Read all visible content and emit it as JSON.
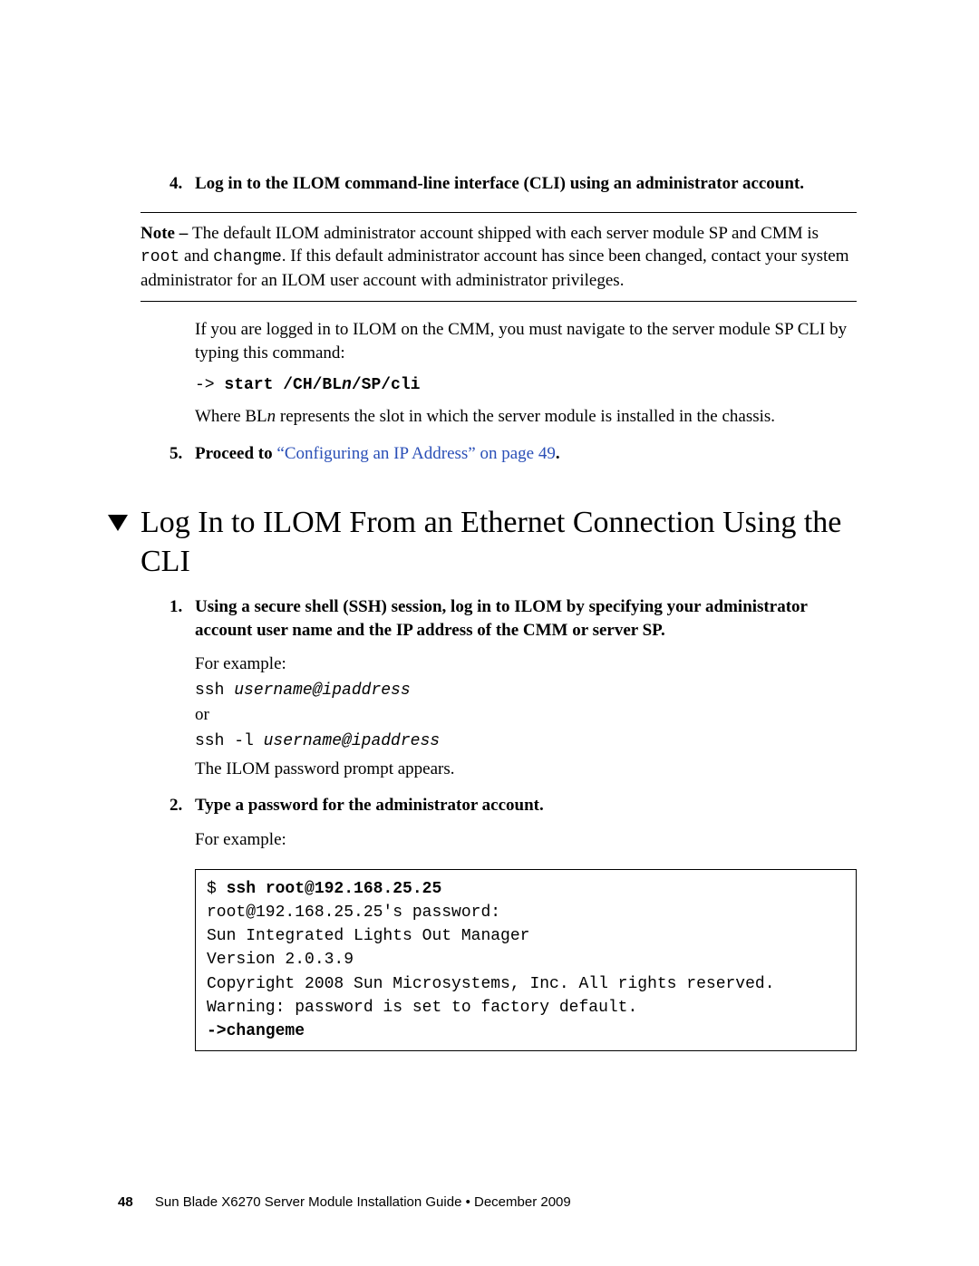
{
  "steps_top": {
    "s4": {
      "num": "4.",
      "text": "Log in to the ILOM command-line interface (CLI) using an administrator account."
    },
    "s5": {
      "num": "5.",
      "prefix": "Proceed to ",
      "link": "“Configuring an IP Address” on page 49",
      "suffix": "."
    }
  },
  "note": {
    "label": "Note – ",
    "t1": "The default ILOM administrator account shipped with each server module SP and CMM is ",
    "code1": "root",
    "t2": " and ",
    "code2": "changme",
    "t3": ". If this default administrator account has since been changed, contact your system administrator for an ILOM user account with administrator privileges."
  },
  "after_note": {
    "p1": "If you are logged in to ILOM on the CMM, you must navigate to the server module SP CLI by typing this command:",
    "cmd_prefix": "-> ",
    "cmd_bold1": "start /CH/BL",
    "cmd_italic": "n",
    "cmd_bold2": "/SP/cli",
    "p2a": "Where BL",
    "p2b": "n",
    "p2c": " represents the slot in which the server module is installed in the chassis."
  },
  "heading": "Log In to ILOM From an Ethernet Connection Using the CLI",
  "steps_bottom": {
    "s1": {
      "num": "1.",
      "text": "Using a secure shell (SSH) session, log in to ILOM by specifying your administrator account user name and the IP address of the CMM or server SP.",
      "p1": "For example:",
      "c1a": "ssh ",
      "c1b": "username@ipaddress",
      "p_or": "or",
      "c2a": "ssh -l ",
      "c2b": "username@ipaddress",
      "p2": "The ILOM password prompt appears."
    },
    "s2": {
      "num": "2.",
      "text": "Type a password for the administrator account.",
      "p1": "For example:"
    }
  },
  "codebox": {
    "l1a": "$ ",
    "l1b": "ssh root@192.168.25.25",
    "l2": "root@192.168.25.25's password:",
    "l3": "Sun Integrated Lights Out Manager",
    "l4": "Version 2.0.3.9",
    "l5": "Copyright 2008 Sun Microsystems, Inc. All rights reserved.",
    "l6": "Warning: password is set to factory default.",
    "l7": "->changeme"
  },
  "footer": {
    "page": "48",
    "text": "Sun Blade X6270 Server Module Installation Guide  •  December 2009"
  }
}
